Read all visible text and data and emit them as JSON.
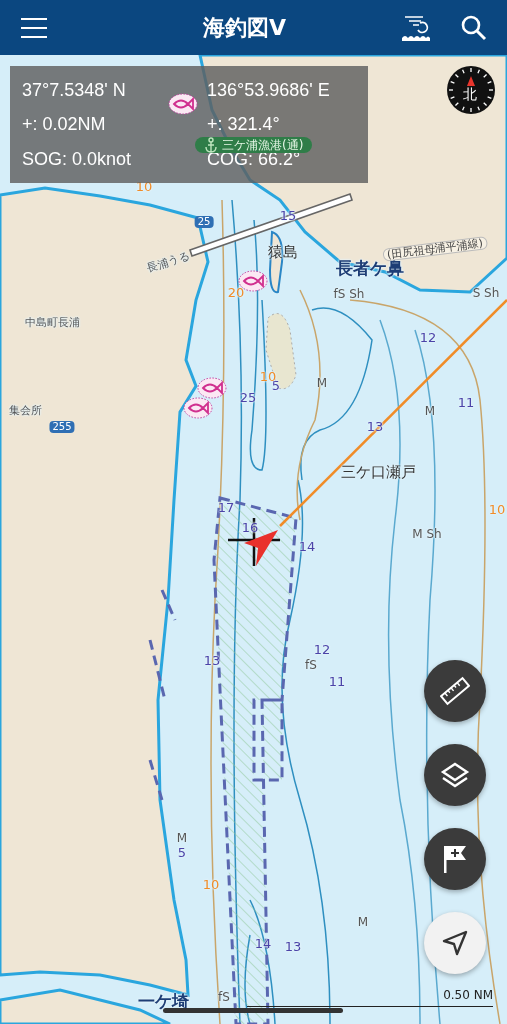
{
  "app_bar": {
    "title": "海釣図Ⅴ"
  },
  "position_panel": {
    "latitude": "37°7.5348' N",
    "longitude": "136°53.9686' E",
    "distance": "+: 0.02NM",
    "bearing": "+: 321.4°",
    "sog": "SOG: 0.0knot",
    "cog": "COG: 66.2°"
  },
  "compass": {
    "label": "北"
  },
  "port": {
    "name": "三ケ浦漁港(通)"
  },
  "map_labels": [
    {
      "kind": "place",
      "text": "猿島"
    },
    {
      "kind": "cape",
      "text": "長者ケ鼻"
    },
    {
      "kind": "place",
      "text": "三ケ口瀬戸"
    },
    {
      "kind": "cape",
      "text": "一ケ埼"
    },
    {
      "kind": "small",
      "text": "長浦うる"
    },
    {
      "kind": "small",
      "text": "中島町長浦"
    },
    {
      "kind": "small",
      "text": "集会所"
    },
    {
      "kind": "road",
      "text": "(田尻祖母浦平浦線)"
    },
    {
      "kind": "route",
      "text": "25"
    },
    {
      "kind": "route",
      "text": "255"
    },
    {
      "kind": "depth",
      "text": "15"
    },
    {
      "kind": "depth",
      "text": "12"
    },
    {
      "kind": "depth",
      "text": "11"
    },
    {
      "kind": "depth",
      "text": "13"
    },
    {
      "kind": "depth",
      "text": "25"
    },
    {
      "kind": "depth",
      "text": "5"
    },
    {
      "kind": "depth",
      "text": "17"
    },
    {
      "kind": "depth",
      "text": "16"
    },
    {
      "kind": "depth",
      "text": "14"
    },
    {
      "kind": "depth",
      "text": "12"
    },
    {
      "kind": "depth",
      "text": "11"
    },
    {
      "kind": "depth",
      "text": "13"
    },
    {
      "kind": "depth",
      "text": "5"
    },
    {
      "kind": "depth",
      "text": "14"
    },
    {
      "kind": "depth",
      "text": "13"
    },
    {
      "kind": "contour",
      "text": "10"
    },
    {
      "kind": "contour",
      "text": "20"
    },
    {
      "kind": "contour",
      "text": "10"
    },
    {
      "kind": "contour",
      "text": "10"
    },
    {
      "kind": "contour",
      "text": "10"
    },
    {
      "kind": "seabed",
      "text": "fS Sh"
    },
    {
      "kind": "seabed",
      "text": "S Sh"
    },
    {
      "kind": "seabed",
      "text": "M"
    },
    {
      "kind": "seabed",
      "text": "M"
    },
    {
      "kind": "seabed",
      "text": "M Sh"
    },
    {
      "kind": "seabed",
      "text": "fS"
    },
    {
      "kind": "seabed",
      "text": "M"
    },
    {
      "kind": "seabed",
      "text": "M"
    },
    {
      "kind": "seabed",
      "text": "fS"
    }
  ],
  "scale": {
    "label": "0.50 NM"
  }
}
